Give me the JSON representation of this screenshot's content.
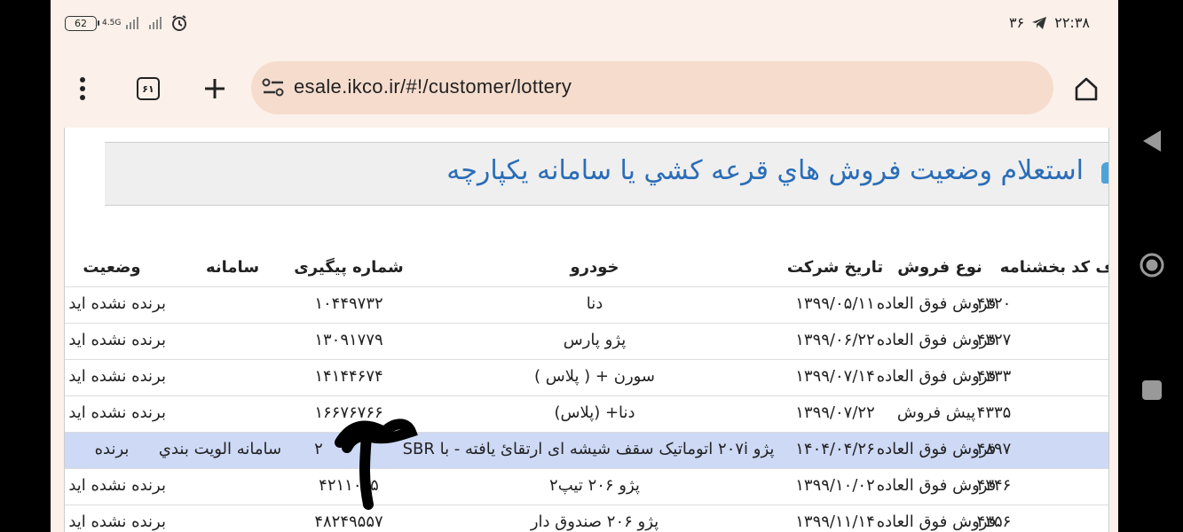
{
  "status_bar": {
    "battery": "62",
    "network": "4.5G",
    "time": "۲۲:۳۸",
    "notification_count": "۳۶"
  },
  "browser": {
    "url": "esale.ikco.ir/#!/customer/lottery",
    "tab_count": "۶۱"
  },
  "page": {
    "title": "استعلام وضعيت فروش هاي قرعه کشي يا سامانه يکپارچه",
    "headers": {
      "code": "ف کد بخشنامه",
      "sale_type": "نوع فروش",
      "reg_date": "تاریخ شرکت",
      "car": "خودرو",
      "tracking": "شماره پیگیری",
      "system": "سامانه",
      "status": "وضعیت"
    },
    "rows": [
      {
        "code": "۴۳۲۰",
        "sale_type": "فروش فوق العاده",
        "reg_date": "۱۳۹۹/۰۵/۱۱",
        "car": "دنا",
        "tracking": "۱۰۴۴۹۷۳۲",
        "system": "",
        "status": "برنده نشده اید"
      },
      {
        "code": "۴۳۲۷",
        "sale_type": "فروش فوق العاده",
        "reg_date": "۱۳۹۹/۰۶/۲۲",
        "car": "پژو پارس",
        "tracking": "۱۳۰۹۱۷۷۹",
        "system": "",
        "status": "برنده نشده اید"
      },
      {
        "code": "۴۳۳۳",
        "sale_type": "فروش فوق العاده",
        "reg_date": "۱۳۹۹/۰۷/۱۴",
        "car": "سورن + ( پلاس )",
        "tracking": "۱۴۱۴۴۶۷۴",
        "system": "",
        "status": "برنده نشده اید"
      },
      {
        "code": "۴۳۳۵",
        "sale_type": "پیش فروش",
        "reg_date": "۱۳۹۹/۰۷/۲۲",
        "car": "دنا+ (پلاس)",
        "tracking": "۱۶۶۷۶۷۶۶",
        "system": "",
        "status": "برنده نشده اید"
      },
      {
        "code": "۴۸۹۷",
        "sale_type": "فروش فوق العاده",
        "reg_date": "۱۴۰۴/۰۴/۲۶",
        "car": "پژو ۲۰۷i اتوماتیک سقف شیشه ای ارتقائ یافته - با SBR",
        "tracking": "۲",
        "system": "سامانه الويت بندي",
        "status": "برنده"
      },
      {
        "code": "۴۳۴۶",
        "sale_type": "فروش فوق العاده",
        "reg_date": "۱۳۹۹/۱۰/۰۲",
        "car": "پژو ۲۰۶ تیپ۲",
        "tracking": "۴۲۱۱۰۰۵",
        "system": "",
        "status": "برنده نشده اید"
      },
      {
        "code": "۴۳۵۶",
        "sale_type": "فروش فوق العاده",
        "reg_date": "۱۳۹۹/۱۱/۱۴",
        "car": "پژو ۲۰۶ صندوق دار",
        "tracking": "۴۸۲۴۹۵۵۷",
        "system": "",
        "status": "برنده نشده اید"
      }
    ]
  },
  "colors": {
    "title": "#2a6db8",
    "selected_row": "#cdd9f5",
    "url_bar": "#f5dccd",
    "chrome_bg": "#fbf1ea"
  }
}
